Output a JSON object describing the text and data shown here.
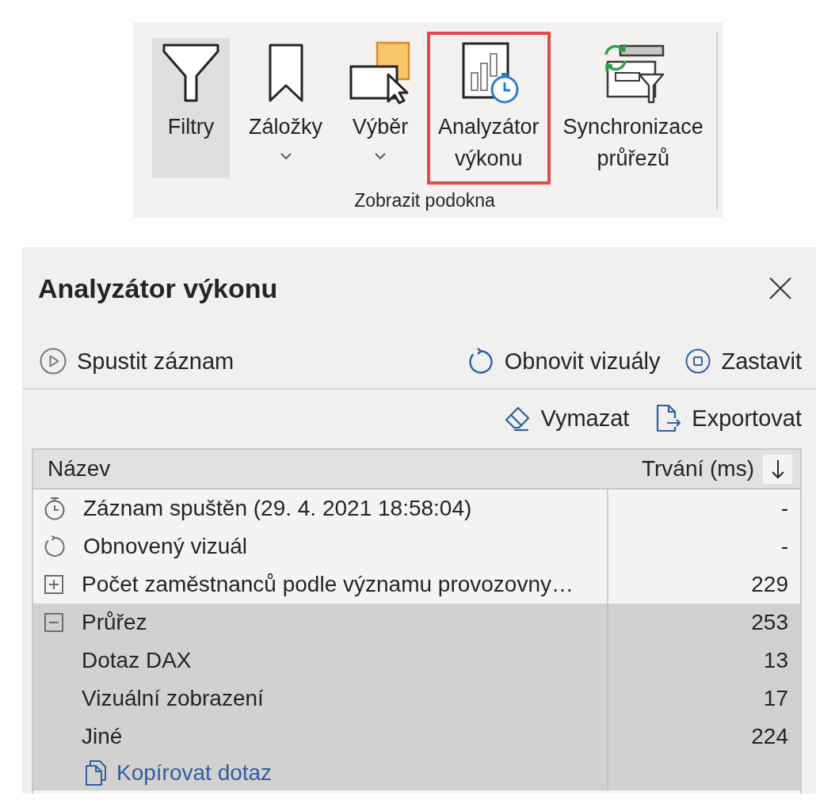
{
  "ribbon": {
    "buttons": [
      {
        "kind": "filters",
        "label": "Filtry",
        "selected": true,
        "dropdown": false,
        "highlighted": false
      },
      {
        "kind": "bookmarks",
        "label": "Záložky",
        "selected": false,
        "dropdown": true,
        "highlighted": false
      },
      {
        "kind": "selection",
        "label": "Výběr",
        "selected": false,
        "dropdown": true,
        "highlighted": false
      },
      {
        "kind": "performance",
        "label": "Analyzátor výkonu",
        "selected": false,
        "dropdown": false,
        "highlighted": true
      },
      {
        "kind": "sync",
        "label": "Synchronizace průřezů",
        "selected": false,
        "dropdown": false,
        "highlighted": false
      }
    ],
    "group_label": "Zobrazit podokna"
  },
  "panel": {
    "title": "Analyzátor výkonu",
    "toolbar": [
      {
        "kind": "start",
        "label": "Spustit záznam",
        "disabled": true
      },
      {
        "kind": "refresh",
        "label": "Obnovit vizuály",
        "disabled": false
      },
      {
        "kind": "stop",
        "label": "Zastavit",
        "disabled": false
      }
    ],
    "actions": [
      {
        "kind": "clear",
        "label": "Vymazat"
      },
      {
        "kind": "export",
        "label": "Exportovat"
      }
    ],
    "table": {
      "columns": [
        {
          "label": "Název"
        },
        {
          "label": "Trvání (ms)",
          "sort_descending": true
        }
      ],
      "rows": [
        {
          "kind": "start",
          "name": "Záznam spuštěn (29. 4. 2021 18:58:04)",
          "duration": "-",
          "selected": false
        },
        {
          "kind": "refresh",
          "name": "Obnovený vizuál",
          "duration": "-",
          "selected": false
        },
        {
          "kind": "visual",
          "name": "Počet zaměstnanců podle významu provozovny…",
          "duration": "229",
          "expanded": false,
          "selected": false
        },
        {
          "kind": "visual",
          "name": "Průřez",
          "duration": "253",
          "expanded": true,
          "selected": true,
          "children": [
            {
              "name": "Dotaz DAX",
              "duration": "13"
            },
            {
              "name": "Vizuální zobrazení",
              "duration": "17"
            },
            {
              "name": "Jiné",
              "duration": "224"
            }
          ],
          "link": "Kopírovat dotaz"
        }
      ]
    }
  }
}
